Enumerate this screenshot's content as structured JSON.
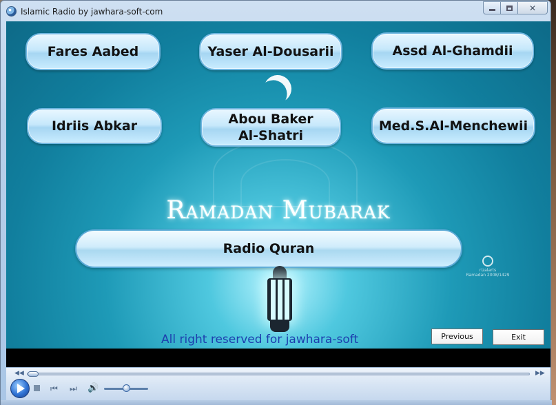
{
  "window": {
    "title": "Islamic Radio by jawhara-soft-com"
  },
  "reciters": [
    {
      "label": "Fares Aabed"
    },
    {
      "label": "Yaser Al-Dousarii"
    },
    {
      "label": "Assd Al-Ghamdii"
    },
    {
      "label": "Idriis Abkar"
    },
    {
      "label": "Abou Baker Al-Shatri"
    },
    {
      "label": "Med.S.Al-Menchewii"
    }
  ],
  "banner": {
    "greeting": "Ramadan Mubarak",
    "watermark_brand": "rizalarts",
    "watermark_year": "Ramadan 2008/1429"
  },
  "radio_button": {
    "label": "Radio Quran"
  },
  "footer": {
    "copyright": "All right reserved for jawhara-soft",
    "previous_label": "Previous",
    "exit_label": "Exit"
  },
  "player": {
    "seek_fraction": 0.0,
    "volume_fraction": 0.5
  },
  "colors": {
    "background_teal": "#1e9ab7",
    "copyright_blue": "#1d3fae",
    "button_face": "#c6e8fb"
  },
  "icons": {
    "app": "radio-icon",
    "play": "play-icon",
    "stop": "stop-icon",
    "prev": "previous-track-icon",
    "next": "next-track-icon",
    "volume": "speaker-icon"
  }
}
